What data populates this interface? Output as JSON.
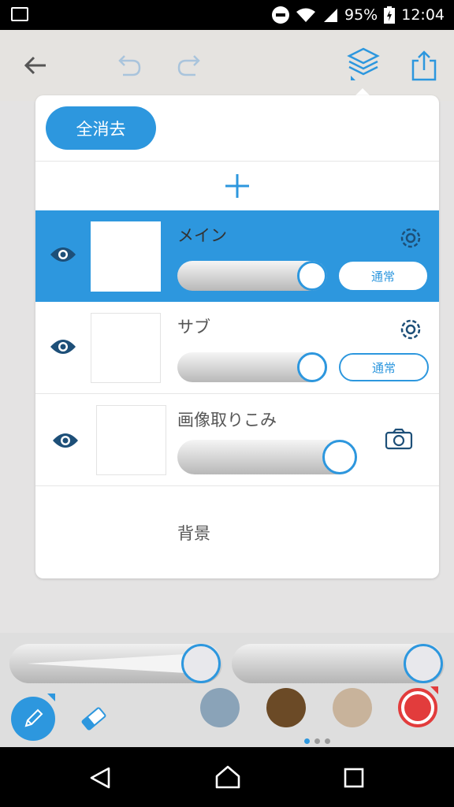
{
  "status_bar": {
    "battery": "95%",
    "time": "12:04",
    "icons": [
      "image-icon",
      "dnd-icon",
      "wifi-icon",
      "signal-icon",
      "battery-charging-icon"
    ]
  },
  "app_bar": {
    "icons": [
      "back-arrow-icon",
      "undo-icon",
      "redo-icon",
      "layers-icon",
      "share-icon"
    ]
  },
  "layer_panel": {
    "clear_all_label": "全消去",
    "add_icon": "plus-icon",
    "layers": [
      {
        "name": "メイン",
        "blend_mode": "通常",
        "selected": true,
        "opacity": 1.0
      },
      {
        "name": "サブ",
        "blend_mode": "通常",
        "selected": false,
        "opacity": 1.0
      },
      {
        "name": "画像取りこみ",
        "selected": false,
        "opacity": 1.0,
        "action_icon": "camera-icon"
      },
      {
        "name": "背景"
      }
    ]
  },
  "tool_bar": {
    "brush_size": 1.0,
    "brush_opacity": 1.0,
    "tools": [
      "pencil-icon",
      "eraser-icon"
    ],
    "colors": [
      "#8aa3b8",
      "#6b4a26",
      "#c8b39b",
      "#e23c3c"
    ],
    "selected_color": "#e23c3c",
    "page_dots": 3,
    "active_page": 0
  },
  "accent_color": "#2d97de",
  "nav_bar": {
    "icons": [
      "back-triangle-icon",
      "home-icon",
      "recents-icon"
    ]
  }
}
